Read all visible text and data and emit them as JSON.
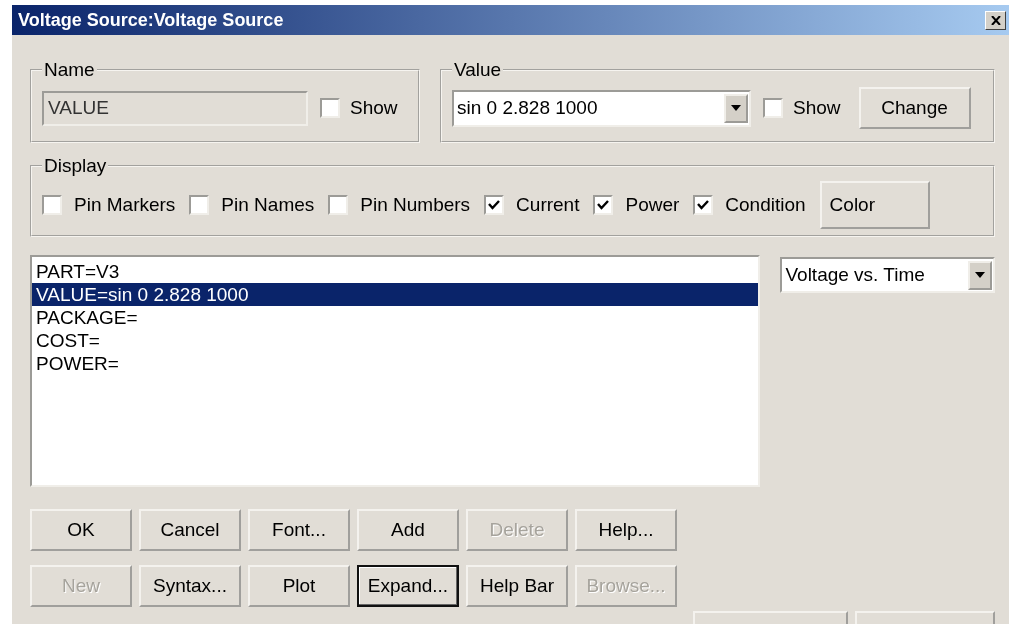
{
  "window": {
    "title": "Voltage Source:Voltage Source"
  },
  "name_group": {
    "label": "Name",
    "value": "VALUE",
    "show": {
      "label": "Show",
      "checked": false
    }
  },
  "value_group": {
    "label": "Value",
    "value": "sin 0 2.828 1000",
    "show": {
      "label": "Show",
      "checked": false
    },
    "change_button": "Change"
  },
  "display_group": {
    "label": "Display",
    "options": [
      {
        "label": "Pin Markers",
        "checked": false
      },
      {
        "label": "Pin Names",
        "checked": false
      },
      {
        "label": "Pin Numbers",
        "checked": false
      },
      {
        "label": "Current",
        "checked": true
      },
      {
        "label": "Power",
        "checked": true
      },
      {
        "label": "Condition",
        "checked": true
      }
    ],
    "color_button": "Color"
  },
  "attributes": [
    {
      "text": "PART=V3",
      "selected": false
    },
    {
      "text": "VALUE=sin 0 2.828 1000",
      "selected": true
    },
    {
      "text": "PACKAGE=",
      "selected": false
    },
    {
      "text": "COST=",
      "selected": false
    },
    {
      "text": "POWER=",
      "selected": false
    }
  ],
  "plot_type": {
    "value": "Voltage vs. Time"
  },
  "button_rows": [
    [
      {
        "label": "OK",
        "disabled": false,
        "focused": false
      },
      {
        "label": "Cancel",
        "disabled": false,
        "focused": false
      },
      {
        "label": "Font...",
        "disabled": false,
        "focused": false
      },
      {
        "label": "Add",
        "disabled": false,
        "focused": false
      },
      {
        "label": "Delete",
        "disabled": true,
        "focused": false
      },
      {
        "label": "Help...",
        "disabled": false,
        "focused": false
      }
    ],
    [
      {
        "label": "New",
        "disabled": true,
        "focused": false
      },
      {
        "label": "Syntax...",
        "disabled": false,
        "focused": false
      },
      {
        "label": "Plot",
        "disabled": false,
        "focused": false
      },
      {
        "label": "Expand...",
        "disabled": false,
        "focused": true
      },
      {
        "label": "Help Bar",
        "disabled": false,
        "focused": false
      },
      {
        "label": "Browse...",
        "disabled": true,
        "focused": false
      }
    ]
  ]
}
